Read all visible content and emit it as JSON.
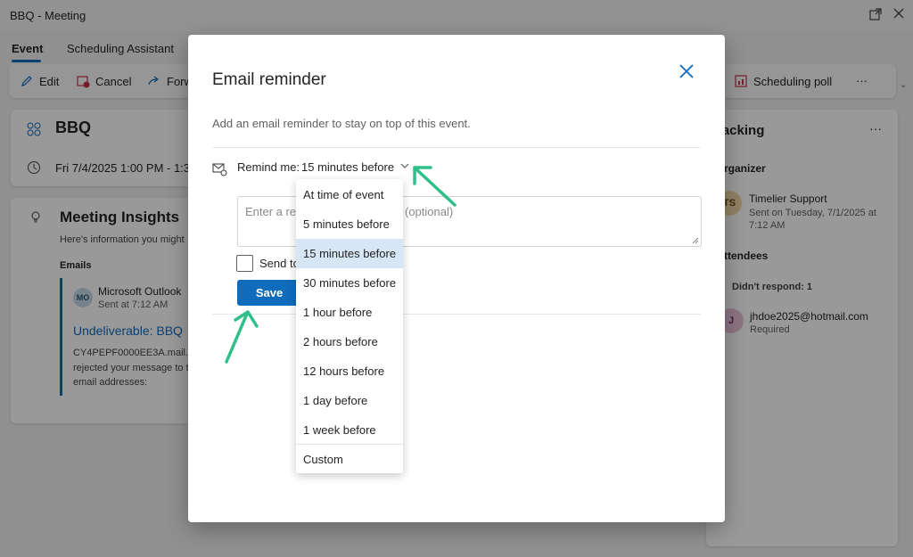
{
  "window": {
    "title": "BBQ - Meeting"
  },
  "tabs": [
    {
      "label": "Event"
    },
    {
      "label": "Scheduling Assistant"
    }
  ],
  "toolbar": {
    "edit": "Edit",
    "cancel": "Cancel",
    "forward": "Forw",
    "scheduling_poll": "Scheduling poll",
    "more": "···"
  },
  "event": {
    "title": "BBQ",
    "datetime": "Fri 7/4/2025 1:00 PM - 1:3"
  },
  "insights": {
    "title": "Meeting Insights",
    "subtitle": "Here's information you might",
    "emails_header": "Emails",
    "email": {
      "avatar": "MO",
      "from": "Microsoft Outlook",
      "sent": "Sent at 7:12 AM",
      "subject": "Undeliverable: BBQ",
      "body1": "CY4PEPF0000EE3A.mail.pro",
      "body2": "rejected your message to t",
      "body3": "email addresses:"
    }
  },
  "tracking": {
    "title": "racking",
    "more": "···",
    "organizer_header": "rganizer",
    "organizer": {
      "avatar": "TS",
      "name": "Timelier Support",
      "sent_line1": "Sent on Tuesday, 7/1/2025 at",
      "sent_line2": "7:12 AM"
    },
    "attendees_header": "ttendees",
    "didnt_respond": "Didn't respond: 1",
    "attendee": {
      "avatar": "J",
      "email": "jhdoe2025@hotmail.com",
      "status": "Required"
    }
  },
  "modal": {
    "title": "Email reminder",
    "description": "Add an email reminder to stay on top of this event.",
    "remind_label": "Remind me:",
    "remind_value": "15 minutes before",
    "message_placeholder_left": "Enter a rem",
    "message_placeholder_right": "(optional)",
    "send_label": "Send to",
    "save_label": "Save"
  },
  "dropdown": {
    "options": [
      "At time of event",
      "5 minutes before",
      "15 minutes before",
      "30 minutes before",
      "1 hour before",
      "2 hours before",
      "12 hours before",
      "1 day before",
      "1 week before",
      "Custom"
    ],
    "selected": "15 minutes before"
  },
  "colors": {
    "accent": "#0f6cbd",
    "selected_bg": "#d6e6f5",
    "annotation_arrow": "#2fbf8a"
  }
}
